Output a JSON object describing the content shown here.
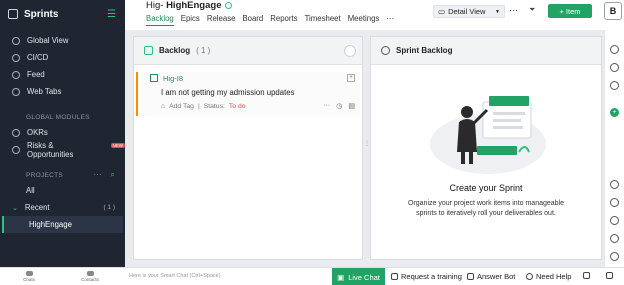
{
  "app": {
    "name": "Sprints"
  },
  "sidebar": {
    "items": [
      {
        "label": "Global View"
      },
      {
        "label": "CI/CD"
      },
      {
        "label": "Feed"
      },
      {
        "label": "Web Tabs"
      }
    ],
    "global_modules_label": "GLOBAL MODULES",
    "modules": [
      {
        "label": "OKRs"
      },
      {
        "label": "Risks & Opportunities",
        "badge": "NEW"
      }
    ],
    "projects_label": "PROJECTS",
    "all_label": "All",
    "recent_label": "Recent",
    "recent_count": "( 1 )",
    "active_project": "HighEngage"
  },
  "header": {
    "project_prefix": "Hig- ",
    "project_name": "HighEngage",
    "tabs": [
      {
        "label": "Backlog",
        "active": true
      },
      {
        "label": "Epics"
      },
      {
        "label": "Release"
      },
      {
        "label": "Board"
      },
      {
        "label": "Reports"
      },
      {
        "label": "Timesheet"
      },
      {
        "label": "Meetings"
      },
      {
        "label": "···"
      }
    ],
    "view_select": "Detail View",
    "add_item": "+ Item",
    "avatar_initial": "B"
  },
  "backlog": {
    "title": "Backlog",
    "count": "( 1 )",
    "card": {
      "id": "Hig-I8",
      "title": "I am not getting my admission updates",
      "add_tag": "Add Tag",
      "separator": "|",
      "status_label": "Status:",
      "status_value": "To do"
    }
  },
  "sprint_backlog": {
    "title": "Sprint Backlog",
    "create_title": "Create your Sprint",
    "create_desc": "Organize your project work items into manageable sprints to iteratively roll your deliverables out."
  },
  "bottom_bar": {
    "chat_label": "Chats",
    "contacts_label": "Contacts",
    "smart_chat_placeholder": "Here is your Smart Chat (Ctrl+Space)",
    "live_chat": "Live Chat",
    "request_training": "Request a training",
    "answer_bot": "Answer Bot",
    "need_help": "Need Help"
  },
  "colors": {
    "accent": "#21a366",
    "sidebar_bg": "#1f2531",
    "status_todo": "#e34b4b",
    "card_priority": "#ff8a00"
  }
}
